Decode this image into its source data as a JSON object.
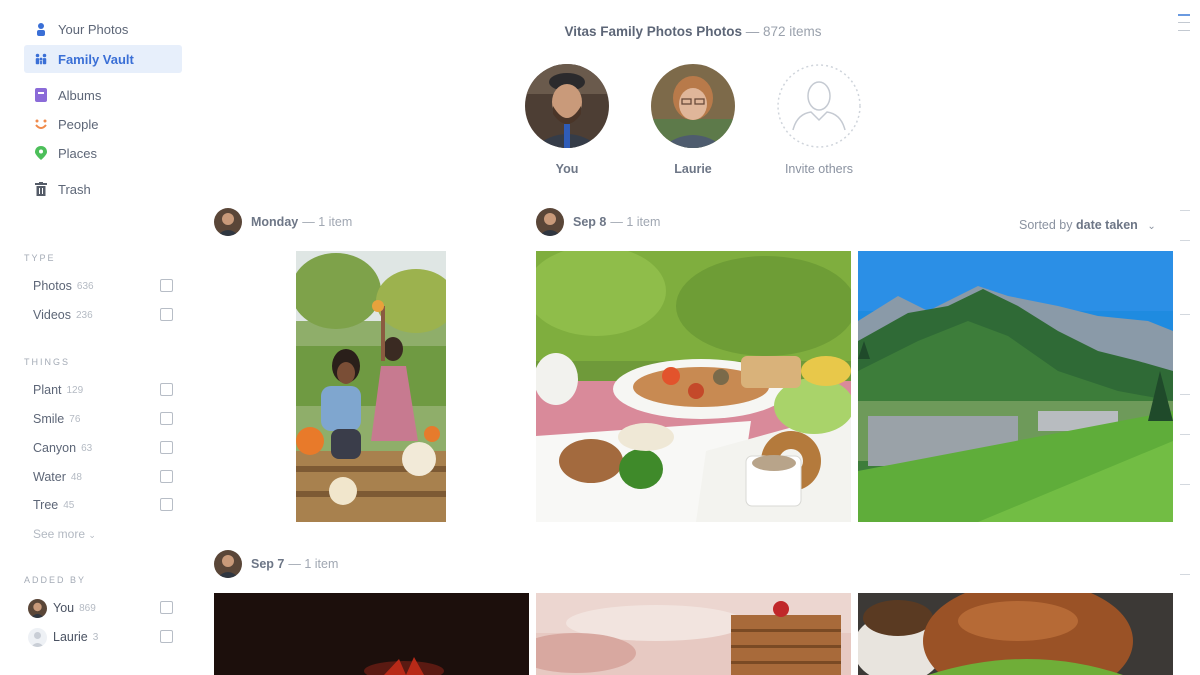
{
  "sidebar": {
    "nav": [
      {
        "label": "Your Photos",
        "icon": "person-icon"
      },
      {
        "label": "Family Vault",
        "icon": "family-icon",
        "active": true
      },
      {
        "label": "Albums",
        "icon": "album-icon"
      },
      {
        "label": "People",
        "icon": "smiley-icon"
      },
      {
        "label": "Places",
        "icon": "pin-icon"
      },
      {
        "label": "Trash",
        "icon": "trash-icon"
      }
    ],
    "type_title": "TYPE",
    "type_filters": [
      {
        "label": "Photos",
        "count": "636"
      },
      {
        "label": "Videos",
        "count": "236"
      }
    ],
    "things_title": "THINGS",
    "things_filters": [
      {
        "label": "Plant",
        "count": "129"
      },
      {
        "label": "Smile",
        "count": "76"
      },
      {
        "label": "Canyon",
        "count": "63"
      },
      {
        "label": "Water",
        "count": "48"
      },
      {
        "label": "Tree",
        "count": "45"
      }
    ],
    "see_more": "See more",
    "added_by_title": "ADDED BY",
    "added_by": [
      {
        "label": "You",
        "count": "869"
      },
      {
        "label": "Laurie",
        "count": "3"
      }
    ]
  },
  "header": {
    "title": "Vitas Family Photos Photos",
    "subtitle": " — 872 items"
  },
  "members": [
    {
      "name": "You"
    },
    {
      "name": "Laurie"
    },
    {
      "name": "Invite others"
    }
  ],
  "groups": [
    {
      "date": "Monday",
      "count": " — 1 item"
    },
    {
      "date": "Sep 8",
      "count": " — 1 item"
    },
    {
      "date": "Sep 7",
      "count": " — 1 item"
    }
  ],
  "sort": {
    "prefix": "Sorted by ",
    "value": "date taken"
  },
  "colors": {
    "accent": "#3a6fd6",
    "active_bg": "#e7effb"
  }
}
